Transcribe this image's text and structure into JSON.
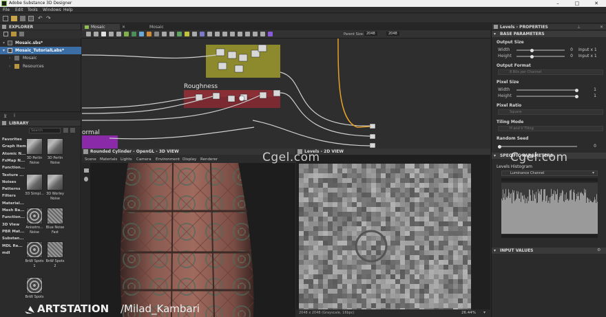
{
  "window": {
    "title": "Adobe Substance 3D Designer",
    "minimize": "–",
    "maximize": "□",
    "close": "✕"
  },
  "menu": [
    "File",
    "Edit",
    "Tools",
    "Windows",
    "Help"
  ],
  "explorer": {
    "title": "EXPLORER",
    "items": [
      {
        "label": "Mosaic.sbs*"
      },
      {
        "label": "Mosaic_TutorialLabs*"
      },
      {
        "label": "Mosaic"
      },
      {
        "label": "Resources"
      }
    ]
  },
  "library": {
    "title": "LIBRARY",
    "search_placeholder": "Search",
    "categories": [
      "Favorites",
      "Graph Items",
      "Atomic N...",
      "FxMap N...",
      "Function...",
      "Texture ...",
      "Noises",
      "Patterns",
      "Filters",
      "Material...",
      "Mesh Ba...",
      "Function...",
      "3D View",
      "PBR Mat...",
      "Substan...",
      "MDL Re...",
      "mdl"
    ],
    "thumbs": [
      {
        "label": "3D Perlin Noise"
      },
      {
        "label": "3D Perlin Noise"
      },
      {
        "label": "3D Simpl..."
      },
      {
        "label": "3D Worley Noise"
      },
      {
        "label": "Anisotro... Noise"
      },
      {
        "label": "Blue Noise Fast"
      },
      {
        "label": "BnW Spots 1"
      },
      {
        "label": "BnW Spots 2"
      },
      {
        "label": "BnW Spots"
      }
    ]
  },
  "graph": {
    "tabs": [
      "Mosaic",
      "Mosaic"
    ],
    "parent_size_label": "Parent Size:",
    "parent_size": "2048",
    "size2": "2048",
    "frames": [
      {
        "title": "Roughness"
      },
      {
        "title": "ormal"
      }
    ]
  },
  "view3d": {
    "title": "Rounded Cylinder - OpenGL - 3D VIEW",
    "menu": [
      "Scene",
      "Materials",
      "Lights",
      "Camera",
      "Environment",
      "Display",
      "Renderer"
    ]
  },
  "view2d": {
    "title": "Levels - 2D VIEW",
    "status": "2048 x 2048 (Grayscale, 16bpc)",
    "zoom": "26.44%"
  },
  "properties": {
    "title": "Levels - PROPERTIES",
    "section": "BASE PARAMETERS",
    "output_size": {
      "label": "Output Size",
      "width_label": "Width",
      "height_label": "Height",
      "width": "0",
      "height": "0",
      "width_rel": "Input x 1",
      "height_rel": "Input x 1"
    },
    "output_format": {
      "label": "Output Format",
      "value": "8 Bits per Channel"
    },
    "pixel_size": {
      "label": "Pixel Size",
      "width_label": "Width",
      "height_label": "Height",
      "width": "1",
      "height": "1"
    },
    "pixel_ratio": {
      "label": "Pixel Ratio",
      "value": "Square"
    },
    "tiling_mode": {
      "label": "Tiling Mode",
      "value": "H and V Tiling"
    },
    "random_seed": {
      "label": "Random Seed",
      "value": "0"
    },
    "specific": "SPECIFIC PARAMETERS",
    "histogram": {
      "label": "Levels Histogram",
      "value": "Luminance Channel"
    },
    "input_values": "INPUT VALUES"
  },
  "watermarks": [
    "Cgel.com",
    "Cgel.com"
  ],
  "artstation": {
    "brand": "ARTSTATION",
    "handle": "/Milad_Kambari"
  },
  "colors": {
    "accent": "#3b8de0",
    "node_yellow": "#8d8a2e",
    "node_red": "#8a2f35",
    "frame_purple": "#8b2aa8"
  }
}
